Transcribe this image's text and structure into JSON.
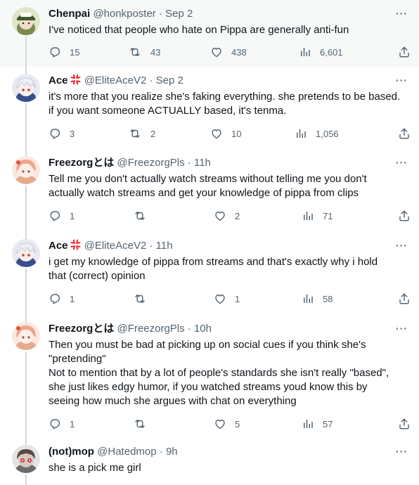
{
  "tweets": [
    {
      "name": "Chenpai",
      "handle": "@honkposter",
      "time": "Sep 2",
      "text": "I've noticed that people who hate on Pippa are generally anti-fun",
      "replies": "15",
      "retweets": "43",
      "likes": "438",
      "views": "6,601"
    },
    {
      "name": "Ace",
      "handle": "@EliteAceV2",
      "time": "Sep 2",
      "text": "it's more that you realize she's faking everything. she pretends to be based.\nif you want someone ACTUALLY based, it's tenma.",
      "replies": "3",
      "retweets": "2",
      "likes": "10",
      "views": "1,056"
    },
    {
      "name": "Freezorgとは",
      "handle": "@FreezorgPls",
      "time": "11h",
      "text": "Tell me you don't actually watch streams without telling me you don't\nactually watch streams and get your knowledge of pippa from clips",
      "replies": "1",
      "retweets": "",
      "likes": "2",
      "views": "71"
    },
    {
      "name": "Ace",
      "handle": "@EliteAceV2",
      "time": "11h",
      "text": "i get my knowledge of pippa from streams and that's exactly why i hold\nthat (correct) opinion",
      "replies": "1",
      "retweets": "",
      "likes": "1",
      "views": "58"
    },
    {
      "name": "Freezorgとは",
      "handle": "@FreezorgPls",
      "time": "10h",
      "text": "Then you must be bad at picking up on social cues if you think she's\n\"pretending\"\nNot to mention that by a lot of people's standards she isn't really \"based\",\nshe just likes edgy humor, if you watched streams youd know this by\nseeing how much she argues with chat on everything",
      "replies": "1",
      "retweets": "",
      "likes": "5",
      "views": "57"
    },
    {
      "name": "(not)mop",
      "handle": "@Hatedmop",
      "time": "9h",
      "text": "she is a pick me girl"
    }
  ],
  "separator": "·",
  "more_glyph": "···",
  "colors": {
    "text": "#0f1419",
    "muted": "#536471",
    "line": "#cfd9de",
    "highlight": "#f7f9f9",
    "anger": "#f4212e"
  },
  "icons": [
    "reply-icon",
    "retweet-icon",
    "like-icon",
    "views-icon",
    "share-icon",
    "more-icon",
    "anger-emoji-icon"
  ]
}
